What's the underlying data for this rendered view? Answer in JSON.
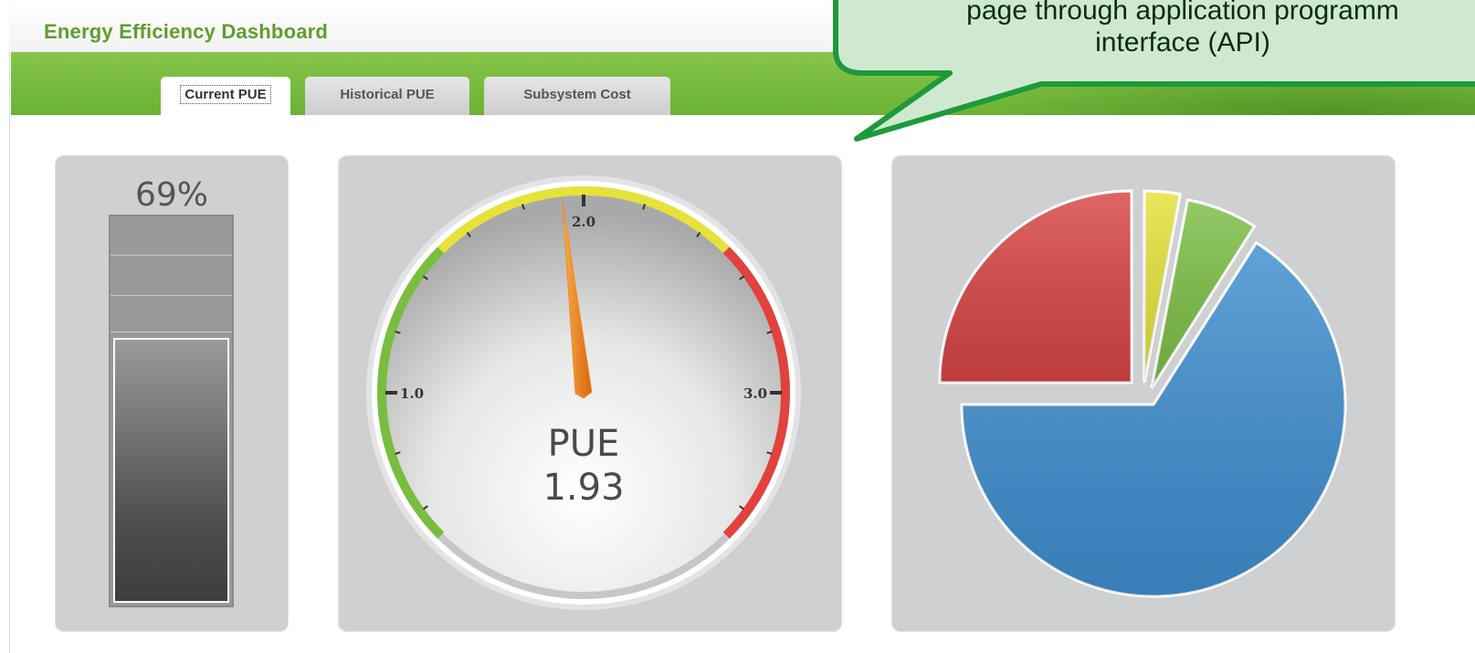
{
  "app": {
    "title": "Energy Efficiency Dashboard"
  },
  "tabs": [
    {
      "label": "Current PUE",
      "active": true
    },
    {
      "label": "Historical PUE",
      "active": false
    },
    {
      "label": "Subsystem Cost",
      "active": false
    }
  ],
  "callout": {
    "line1": "page through application programm",
    "line2": "interface (API)",
    "fill": "#cfe9d0",
    "border": "#1e9a3a"
  },
  "bar_panel": {
    "percent_label": "69%",
    "fill_fraction": 0.69
  },
  "gauge": {
    "label": "PUE",
    "value_label": "1.93",
    "value": 1.93,
    "min": 0.5,
    "max": 3.5,
    "tick_labels": [
      "1.0",
      "2.0",
      "3.0"
    ],
    "colors": {
      "green": "#79bd3f",
      "yellow": "#e6e23a",
      "red": "#e2423e",
      "needle": "#f08c22"
    }
  },
  "chart_data": {
    "type": "pie",
    "values": [
      3,
      6,
      66,
      25
    ],
    "colors": [
      "#e6e23a",
      "#7cbf45",
      "#3f8fd0",
      "#d94545"
    ]
  }
}
